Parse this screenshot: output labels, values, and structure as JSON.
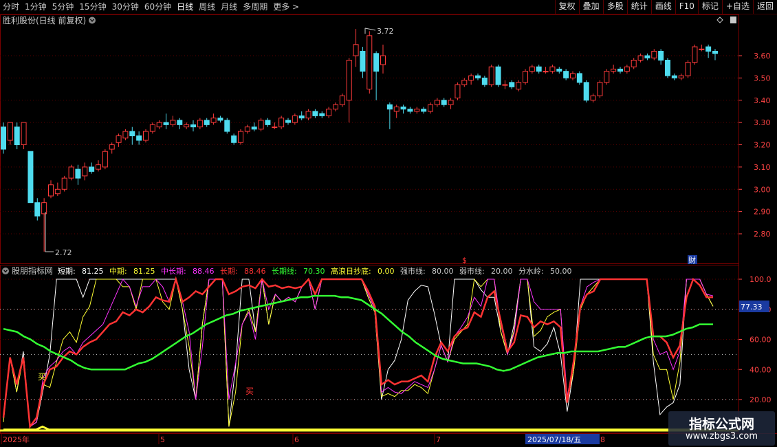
{
  "toolbar": {
    "periods": [
      "分时",
      "1分钟",
      "5分钟",
      "15分钟",
      "30分钟",
      "60分钟",
      "日线",
      "周线",
      "月线",
      "多周期",
      "更多 >"
    ],
    "active_period": "日线",
    "buttons": [
      "复权",
      "叠加",
      "多股",
      "统计",
      "画线",
      "F10",
      "标记",
      "+自选",
      "返回"
    ]
  },
  "main_panel": {
    "title": "胜利股份(日线 前复权)",
    "high_label": "3.72",
    "low_label": "2.72",
    "marker_s": "$",
    "marker_cai": "财",
    "price_ticks": [
      "3.60",
      "3.50",
      "3.40",
      "3.30",
      "3.20",
      "3.10",
      "3.00",
      "2.90",
      "2.80"
    ]
  },
  "indicator_panel": {
    "name": "股朋指标网",
    "legend": [
      {
        "label": "短期:",
        "value": "81.25",
        "color": "#ffffff"
      },
      {
        "label": "中期:",
        "value": "81.25",
        "color": "#ffff33"
      },
      {
        "label": "中长期:",
        "value": "88.46",
        "color": "#ff33ff"
      },
      {
        "label": "长期:",
        "value": "88.46",
        "color": "#ff3333"
      },
      {
        "label": "长期线:",
        "value": "70.30",
        "color": "#33ff33"
      },
      {
        "label": "高浪日抄底:",
        "value": "0.00",
        "color": "#ffff33"
      },
      {
        "label": "强市线:",
        "value": "80.00",
        "color": "#c8c8c8"
      },
      {
        "label": "弱市线:",
        "value": "20.00",
        "color": "#c8c8c8"
      },
      {
        "label": "分水岭:",
        "value": "50.00",
        "color": "#c8c8c8"
      }
    ],
    "ticks": [
      "100.0",
      "80.00",
      "60.00",
      "40.00",
      "20.00"
    ],
    "current_value_badge": "77.33",
    "buy_marks": [
      "买",
      "买"
    ]
  },
  "date_axis": {
    "labels": [
      "2025年",
      "5",
      "6",
      "7",
      "8"
    ],
    "cursor_date": "2025/07/18/五"
  },
  "watermark": {
    "title": "指标公式网",
    "subtitle": "www.zbgs3.com"
  },
  "chart_data": {
    "type": "candlestick",
    "price_range": [
      2.72,
      3.72
    ],
    "candles": [
      [
        3.28,
        3.18,
        3.3,
        3.16
      ],
      [
        3.22,
        3.3,
        3.3,
        3.2
      ],
      [
        3.28,
        3.2,
        3.3,
        3.18
      ],
      [
        3.2,
        3.3,
        3.3,
        3.18
      ],
      [
        3.17,
        2.94,
        3.17,
        2.94
      ],
      [
        2.94,
        2.88,
        2.96,
        2.86
      ],
      [
        2.89,
        2.94,
        2.96,
        2.72
      ],
      [
        2.97,
        3.02,
        3.04,
        2.96
      ],
      [
        2.98,
        3.0,
        3.03,
        2.97
      ],
      [
        3.0,
        3.05,
        3.06,
        2.99
      ],
      [
        3.05,
        3.1,
        3.11,
        3.04
      ],
      [
        3.09,
        3.05,
        3.11,
        3.02
      ],
      [
        3.06,
        3.1,
        3.12,
        3.04
      ],
      [
        3.1,
        3.08,
        3.12,
        3.07
      ],
      [
        3.09,
        3.11,
        3.13,
        3.08
      ],
      [
        3.1,
        3.17,
        3.18,
        3.09
      ],
      [
        3.18,
        3.2,
        3.21,
        3.16
      ],
      [
        3.21,
        3.24,
        3.25,
        3.19
      ],
      [
        3.23,
        3.26,
        3.27,
        3.22
      ],
      [
        3.26,
        3.24,
        3.28,
        3.2
      ],
      [
        3.24,
        3.22,
        3.26,
        3.2
      ],
      [
        3.22,
        3.26,
        3.27,
        3.21
      ],
      [
        3.26,
        3.29,
        3.3,
        3.25
      ],
      [
        3.28,
        3.3,
        3.31,
        3.27
      ],
      [
        3.3,
        3.29,
        3.34,
        3.27
      ],
      [
        3.29,
        3.31,
        3.33,
        3.28
      ],
      [
        3.31,
        3.29,
        3.32,
        3.27
      ],
      [
        3.28,
        3.29,
        3.3,
        3.27
      ],
      [
        3.29,
        3.28,
        3.31,
        3.26
      ],
      [
        3.28,
        3.31,
        3.32,
        3.27
      ],
      [
        3.31,
        3.29,
        3.32,
        3.28
      ],
      [
        3.3,
        3.32,
        3.34,
        3.29
      ],
      [
        3.32,
        3.31,
        3.33,
        3.3
      ],
      [
        3.31,
        3.26,
        3.32,
        3.25
      ],
      [
        3.24,
        3.21,
        3.25,
        3.2
      ],
      [
        3.21,
        3.26,
        3.27,
        3.2
      ],
      [
        3.26,
        3.28,
        3.29,
        3.25
      ],
      [
        3.28,
        3.27,
        3.3,
        3.26
      ],
      [
        3.27,
        3.31,
        3.32,
        3.26
      ],
      [
        3.31,
        3.29,
        3.32,
        3.28
      ],
      [
        3.28,
        3.28,
        3.3,
        3.27
      ],
      [
        3.28,
        3.32,
        3.33,
        3.27
      ],
      [
        3.31,
        3.3,
        3.32,
        3.29
      ],
      [
        3.3,
        3.33,
        3.34,
        3.29
      ],
      [
        3.33,
        3.32,
        3.35,
        3.31
      ],
      [
        3.32,
        3.35,
        3.36,
        3.31
      ],
      [
        3.35,
        3.33,
        3.36,
        3.32
      ],
      [
        3.34,
        3.33,
        3.35,
        3.32
      ],
      [
        3.33,
        3.36,
        3.37,
        3.32
      ],
      [
        3.36,
        3.38,
        3.39,
        3.35
      ],
      [
        3.38,
        3.42,
        3.43,
        3.37
      ],
      [
        3.4,
        3.58,
        3.59,
        3.3
      ],
      [
        3.6,
        3.65,
        3.72,
        3.55
      ],
      [
        3.62,
        3.53,
        3.64,
        3.5
      ],
      [
        3.45,
        3.69,
        3.71,
        3.43
      ],
      [
        3.61,
        3.53,
        3.62,
        3.4
      ],
      [
        3.56,
        3.6,
        3.65,
        3.52
      ],
      [
        3.38,
        3.36,
        3.39,
        3.27
      ],
      [
        3.35,
        3.37,
        3.38,
        3.32
      ],
      [
        3.37,
        3.36,
        3.38,
        3.34
      ],
      [
        3.36,
        3.35,
        3.37,
        3.34
      ],
      [
        3.35,
        3.36,
        3.37,
        3.34
      ],
      [
        3.36,
        3.35,
        3.37,
        3.34
      ],
      [
        3.35,
        3.38,
        3.39,
        3.34
      ],
      [
        3.38,
        3.4,
        3.41,
        3.37
      ],
      [
        3.4,
        3.38,
        3.41,
        3.37
      ],
      [
        3.38,
        3.4,
        3.41,
        3.36
      ],
      [
        3.41,
        3.47,
        3.48,
        3.4
      ],
      [
        3.47,
        3.49,
        3.5,
        3.46
      ],
      [
        3.49,
        3.51,
        3.52,
        3.47
      ],
      [
        3.51,
        3.5,
        3.52,
        3.49
      ],
      [
        3.5,
        3.47,
        3.51,
        3.46
      ],
      [
        3.47,
        3.55,
        3.56,
        3.46
      ],
      [
        3.55,
        3.47,
        3.56,
        3.46
      ],
      [
        3.47,
        3.47,
        3.49,
        3.45
      ],
      [
        3.48,
        3.46,
        3.49,
        3.45
      ],
      [
        3.45,
        3.48,
        3.49,
        3.44
      ],
      [
        3.48,
        3.53,
        3.54,
        3.47
      ],
      [
        3.53,
        3.55,
        3.56,
        3.52
      ],
      [
        3.55,
        3.53,
        3.56,
        3.52
      ],
      [
        3.53,
        3.53,
        3.55,
        3.52
      ],
      [
        3.53,
        3.55,
        3.56,
        3.52
      ],
      [
        3.54,
        3.53,
        3.55,
        3.52
      ],
      [
        3.53,
        3.5,
        3.54,
        3.49
      ],
      [
        3.5,
        3.52,
        3.53,
        3.49
      ],
      [
        3.52,
        3.48,
        3.53,
        3.47
      ],
      [
        3.48,
        3.4,
        3.49,
        3.39
      ],
      [
        3.4,
        3.42,
        3.43,
        3.39
      ],
      [
        3.42,
        3.48,
        3.49,
        3.41
      ],
      [
        3.48,
        3.53,
        3.54,
        3.47
      ],
      [
        3.53,
        3.54,
        3.56,
        3.52
      ],
      [
        3.54,
        3.53,
        3.55,
        3.52
      ],
      [
        3.53,
        3.55,
        3.56,
        3.52
      ],
      [
        3.55,
        3.58,
        3.59,
        3.54
      ],
      [
        3.58,
        3.6,
        3.61,
        3.57
      ],
      [
        3.6,
        3.59,
        3.61,
        3.58
      ],
      [
        3.59,
        3.62,
        3.63,
        3.58
      ],
      [
        3.62,
        3.58,
        3.63,
        3.56
      ],
      [
        3.58,
        3.51,
        3.59,
        3.5
      ],
      [
        3.51,
        3.5,
        3.52,
        3.49
      ],
      [
        3.5,
        3.51,
        3.52,
        3.49
      ],
      [
        3.51,
        3.57,
        3.58,
        3.5
      ],
      [
        3.57,
        3.64,
        3.65,
        3.56
      ],
      [
        3.63,
        3.63,
        3.65,
        3.62
      ],
      [
        3.64,
        3.62,
        3.65,
        3.59
      ],
      [
        3.62,
        3.61,
        3.63,
        3.58
      ]
    ],
    "indicator_range": [
      0,
      100
    ],
    "series": [
      {
        "name": "短期",
        "color": "#ffffff",
        "values": [
          8,
          48,
          25,
          52,
          2,
          5,
          27,
          50,
          100,
          100,
          100,
          100,
          88,
          100,
          100,
          100,
          100,
          100,
          100,
          100,
          100,
          100,
          100,
          100,
          100,
          100,
          100,
          80,
          40,
          20,
          70,
          100,
          100,
          100,
          2,
          42,
          100,
          100,
          65,
          100,
          70,
          90,
          85,
          88,
          85,
          95,
          100,
          80,
          100,
          100,
          100,
          100,
          100,
          100,
          100,
          88,
          78,
          20,
          40,
          46,
          60,
          86,
          92,
          96,
          95,
          77,
          56,
          45,
          100,
          100,
          100,
          100,
          93,
          88,
          88,
          65,
          50,
          70,
          100,
          100,
          55,
          52,
          57,
          68,
          50,
          12,
          40,
          100,
          100,
          100,
          100,
          100,
          100,
          100,
          100,
          100,
          100,
          100,
          45,
          10,
          15,
          18,
          30,
          100,
          100,
          100,
          90,
          82
        ]
      },
      {
        "name": "中期",
        "color": "#ffff33",
        "values": [
          5,
          48,
          25,
          48,
          2,
          5,
          30,
          28,
          45,
          60,
          65,
          58,
          75,
          82,
          100,
          100,
          100,
          100,
          95,
          95,
          80,
          100,
          100,
          100,
          85,
          80,
          100,
          80,
          55,
          20,
          70,
          100,
          100,
          100,
          2,
          25,
          70,
          80,
          65,
          100,
          70,
          90,
          85,
          88,
          85,
          95,
          100,
          80,
          100,
          100,
          100,
          100,
          100,
          100,
          100,
          88,
          78,
          22,
          24,
          22,
          26,
          26,
          30,
          28,
          24,
          40,
          56,
          45,
          60,
          65,
          70,
          100,
          95,
          100,
          100,
          65,
          50,
          66,
          100,
          100,
          62,
          66,
          75,
          78,
          80,
          18,
          40,
          80,
          90,
          95,
          100,
          100,
          100,
          100,
          100,
          100,
          100,
          100,
          50,
          40,
          40,
          20,
          45,
          100,
          100,
          100,
          90,
          82
        ]
      },
      {
        "name": "中长期",
        "color": "#ff33ff",
        "values": [
          10,
          48,
          30,
          48,
          2,
          5,
          35,
          42,
          46,
          52,
          55,
          50,
          58,
          62,
          66,
          70,
          80,
          90,
          100,
          95,
          82,
          95,
          95,
          100,
          95,
          85,
          100,
          85,
          65,
          20,
          55,
          100,
          100,
          100,
          20,
          44,
          70,
          78,
          60,
          100,
          80,
          90,
          85,
          88,
          85,
          95,
          100,
          80,
          100,
          100,
          100,
          100,
          100,
          100,
          100,
          90,
          80,
          25,
          28,
          25,
          24,
          28,
          32,
          30,
          28,
          40,
          56,
          45,
          62,
          68,
          75,
          88,
          82,
          100,
          100,
          70,
          50,
          64,
          100,
          100,
          85,
          80,
          80,
          80,
          80,
          22,
          44,
          82,
          95,
          98,
          100,
          100,
          100,
          100,
          100,
          100,
          100,
          100,
          60,
          50,
          52,
          40,
          52,
          100,
          100,
          100,
          90,
          89
        ]
      },
      {
        "name": "长期",
        "color": "#ff3333",
        "values": [
          8,
          48,
          30,
          48,
          2,
          8,
          30,
          40,
          42,
          48,
          52,
          50,
          55,
          58,
          60,
          65,
          70,
          72,
          78,
          76,
          80,
          78,
          82,
          88,
          86,
          85,
          100,
          85,
          88,
          92,
          90,
          95,
          100,
          100,
          90,
          92,
          95,
          96,
          94,
          100,
          95,
          96,
          94,
          95,
          94,
          95,
          100,
          90,
          100,
          100,
          100,
          100,
          100,
          100,
          100,
          92,
          82,
          30,
          33,
          30,
          32,
          32,
          34,
          36,
          32,
          48,
          58,
          52,
          62,
          66,
          68,
          78,
          75,
          88,
          92,
          72,
          52,
          58,
          76,
          75,
          68,
          72,
          70,
          72,
          68,
          18,
          46,
          82,
          90,
          92,
          100,
          100,
          100,
          100,
          100,
          100,
          100,
          100,
          62,
          62,
          58,
          48,
          56,
          88,
          100,
          96,
          88,
          88
        ]
      },
      {
        "name": "长期线",
        "color": "#33ff33",
        "values": [
          67,
          66,
          65,
          62,
          60,
          57,
          55,
          52,
          50,
          48,
          46,
          43,
          41,
          40,
          40,
          40,
          40,
          40,
          40,
          42,
          44,
          45,
          47,
          50,
          53,
          56,
          59,
          62,
          64,
          67,
          70,
          72,
          74,
          76,
          77,
          79,
          80,
          81,
          82,
          83,
          84,
          85,
          86,
          87,
          88,
          88,
          89,
          89,
          89,
          89,
          88,
          88,
          87,
          86,
          83,
          80,
          77,
          73,
          69,
          65,
          62,
          58,
          55,
          52,
          49,
          47,
          46,
          45,
          44,
          44,
          44,
          43,
          42,
          40,
          39,
          40,
          42,
          44,
          46,
          48,
          49,
          50,
          51,
          51,
          52,
          52,
          52,
          52,
          52,
          53,
          54,
          55,
          55,
          57,
          59,
          61,
          62,
          62,
          62,
          63,
          65,
          67,
          68,
          70,
          70,
          70
        ]
      },
      {
        "name": "高浪日抄底",
        "color": "#ffff33",
        "values": [
          0,
          0,
          0,
          0,
          0,
          0,
          2,
          0,
          0,
          0,
          0,
          0,
          0,
          0,
          0,
          0,
          0,
          0,
          0,
          0,
          0,
          0,
          0,
          0,
          0,
          0,
          0,
          0,
          0,
          0,
          0,
          0,
          0,
          0,
          0,
          0,
          0,
          0,
          0,
          0,
          0,
          0,
          0,
          0,
          0,
          0,
          0,
          0,
          0,
          0,
          0,
          0,
          0,
          0,
          0,
          0,
          0,
          0,
          0,
          0,
          0,
          0,
          0,
          0,
          0,
          0,
          0,
          0,
          0,
          0,
          0,
          0,
          0,
          0,
          0,
          0,
          0,
          0,
          0,
          0,
          0,
          0,
          0,
          0,
          0,
          0,
          0,
          0,
          0,
          0,
          0,
          0,
          0,
          0,
          0,
          0,
          0,
          0,
          0,
          0,
          0,
          0,
          0,
          0,
          0,
          0,
          0,
          0,
          0,
          0
        ]
      }
    ],
    "reference_lines": [
      80,
      50,
      20
    ]
  }
}
